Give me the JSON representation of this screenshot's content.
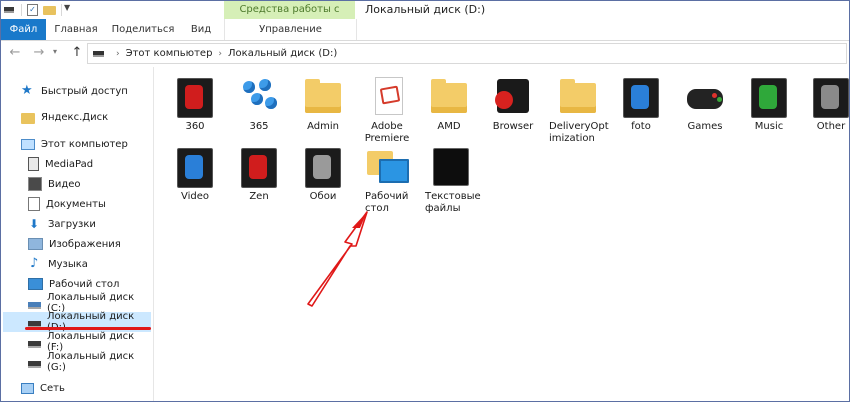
{
  "titlebar": {
    "context_tab_header": "Средства работы с дисками",
    "window_title": "Локальный диск (D:)"
  },
  "ribbon": {
    "tabs": [
      {
        "label": "Файл"
      },
      {
        "label": "Главная"
      },
      {
        "label": "Поделиться"
      },
      {
        "label": "Вид"
      },
      {
        "label": "Управление"
      }
    ]
  },
  "address": {
    "crumbs": [
      "Этот компьютер",
      "Локальный диск (D:)"
    ]
  },
  "navpane": {
    "items": [
      {
        "label": "Быстрый доступ",
        "icon": "star-icon"
      },
      {
        "label": "Яндекс.Диск",
        "icon": "folder-icon"
      },
      {
        "label": "Этот компьютер",
        "icon": "computer-icon"
      },
      {
        "label": "MediaPad",
        "icon": "phone-icon"
      },
      {
        "label": "Видео",
        "icon": "video-icon"
      },
      {
        "label": "Документы",
        "icon": "document-icon"
      },
      {
        "label": "Загрузки",
        "icon": "download-icon"
      },
      {
        "label": "Изображения",
        "icon": "image-icon"
      },
      {
        "label": "Музыка",
        "icon": "music-icon"
      },
      {
        "label": "Рабочий стол",
        "icon": "desktop-icon"
      },
      {
        "label": "Локальный диск (C:)",
        "icon": "drive-icon"
      },
      {
        "label": "Локальный диск (D:)",
        "icon": "drive-icon",
        "selected": true
      },
      {
        "label": "Локальный диск (F:)",
        "icon": "drive-icon"
      },
      {
        "label": "Локальный диск (G:)",
        "icon": "drive-icon"
      },
      {
        "label": "Сеть",
        "icon": "network-icon"
      }
    ]
  },
  "files": {
    "items": [
      {
        "label": "360",
        "icon": "dark-red-app-icon"
      },
      {
        "label": "365",
        "icon": "blue-dots-icon"
      },
      {
        "label": "Admin",
        "icon": "folder-icon"
      },
      {
        "label": "Adobe Premiere",
        "icon": "pdf-icon"
      },
      {
        "label": "AMD",
        "icon": "folder-icon"
      },
      {
        "label": "Browser",
        "icon": "browser-icon"
      },
      {
        "label": "DeliveryOptimization",
        "icon": "folder-icon"
      },
      {
        "label": "foto",
        "icon": "dark-blue-app-icon"
      },
      {
        "label": "Games",
        "icon": "gamepad-icon"
      },
      {
        "label": "Music",
        "icon": "dark-green-app-icon"
      },
      {
        "label": "Other",
        "icon": "dark-gray-app-icon"
      },
      {
        "label": "Video",
        "icon": "dark-blue-film-icon"
      },
      {
        "label": "Zen",
        "icon": "dark-red-app-icon"
      },
      {
        "label": "Обои",
        "icon": "dark-gray-app-icon"
      },
      {
        "label": "Рабочий стол",
        "icon": "desktop-folder-icon"
      },
      {
        "label": "Текстовые файлы",
        "icon": "tablet-icon"
      }
    ]
  },
  "colors": {
    "file_tab": "#1979ca",
    "context_tab": "#d6efb7",
    "selection": "#cce8ff",
    "annotation_red": "#e01818"
  }
}
